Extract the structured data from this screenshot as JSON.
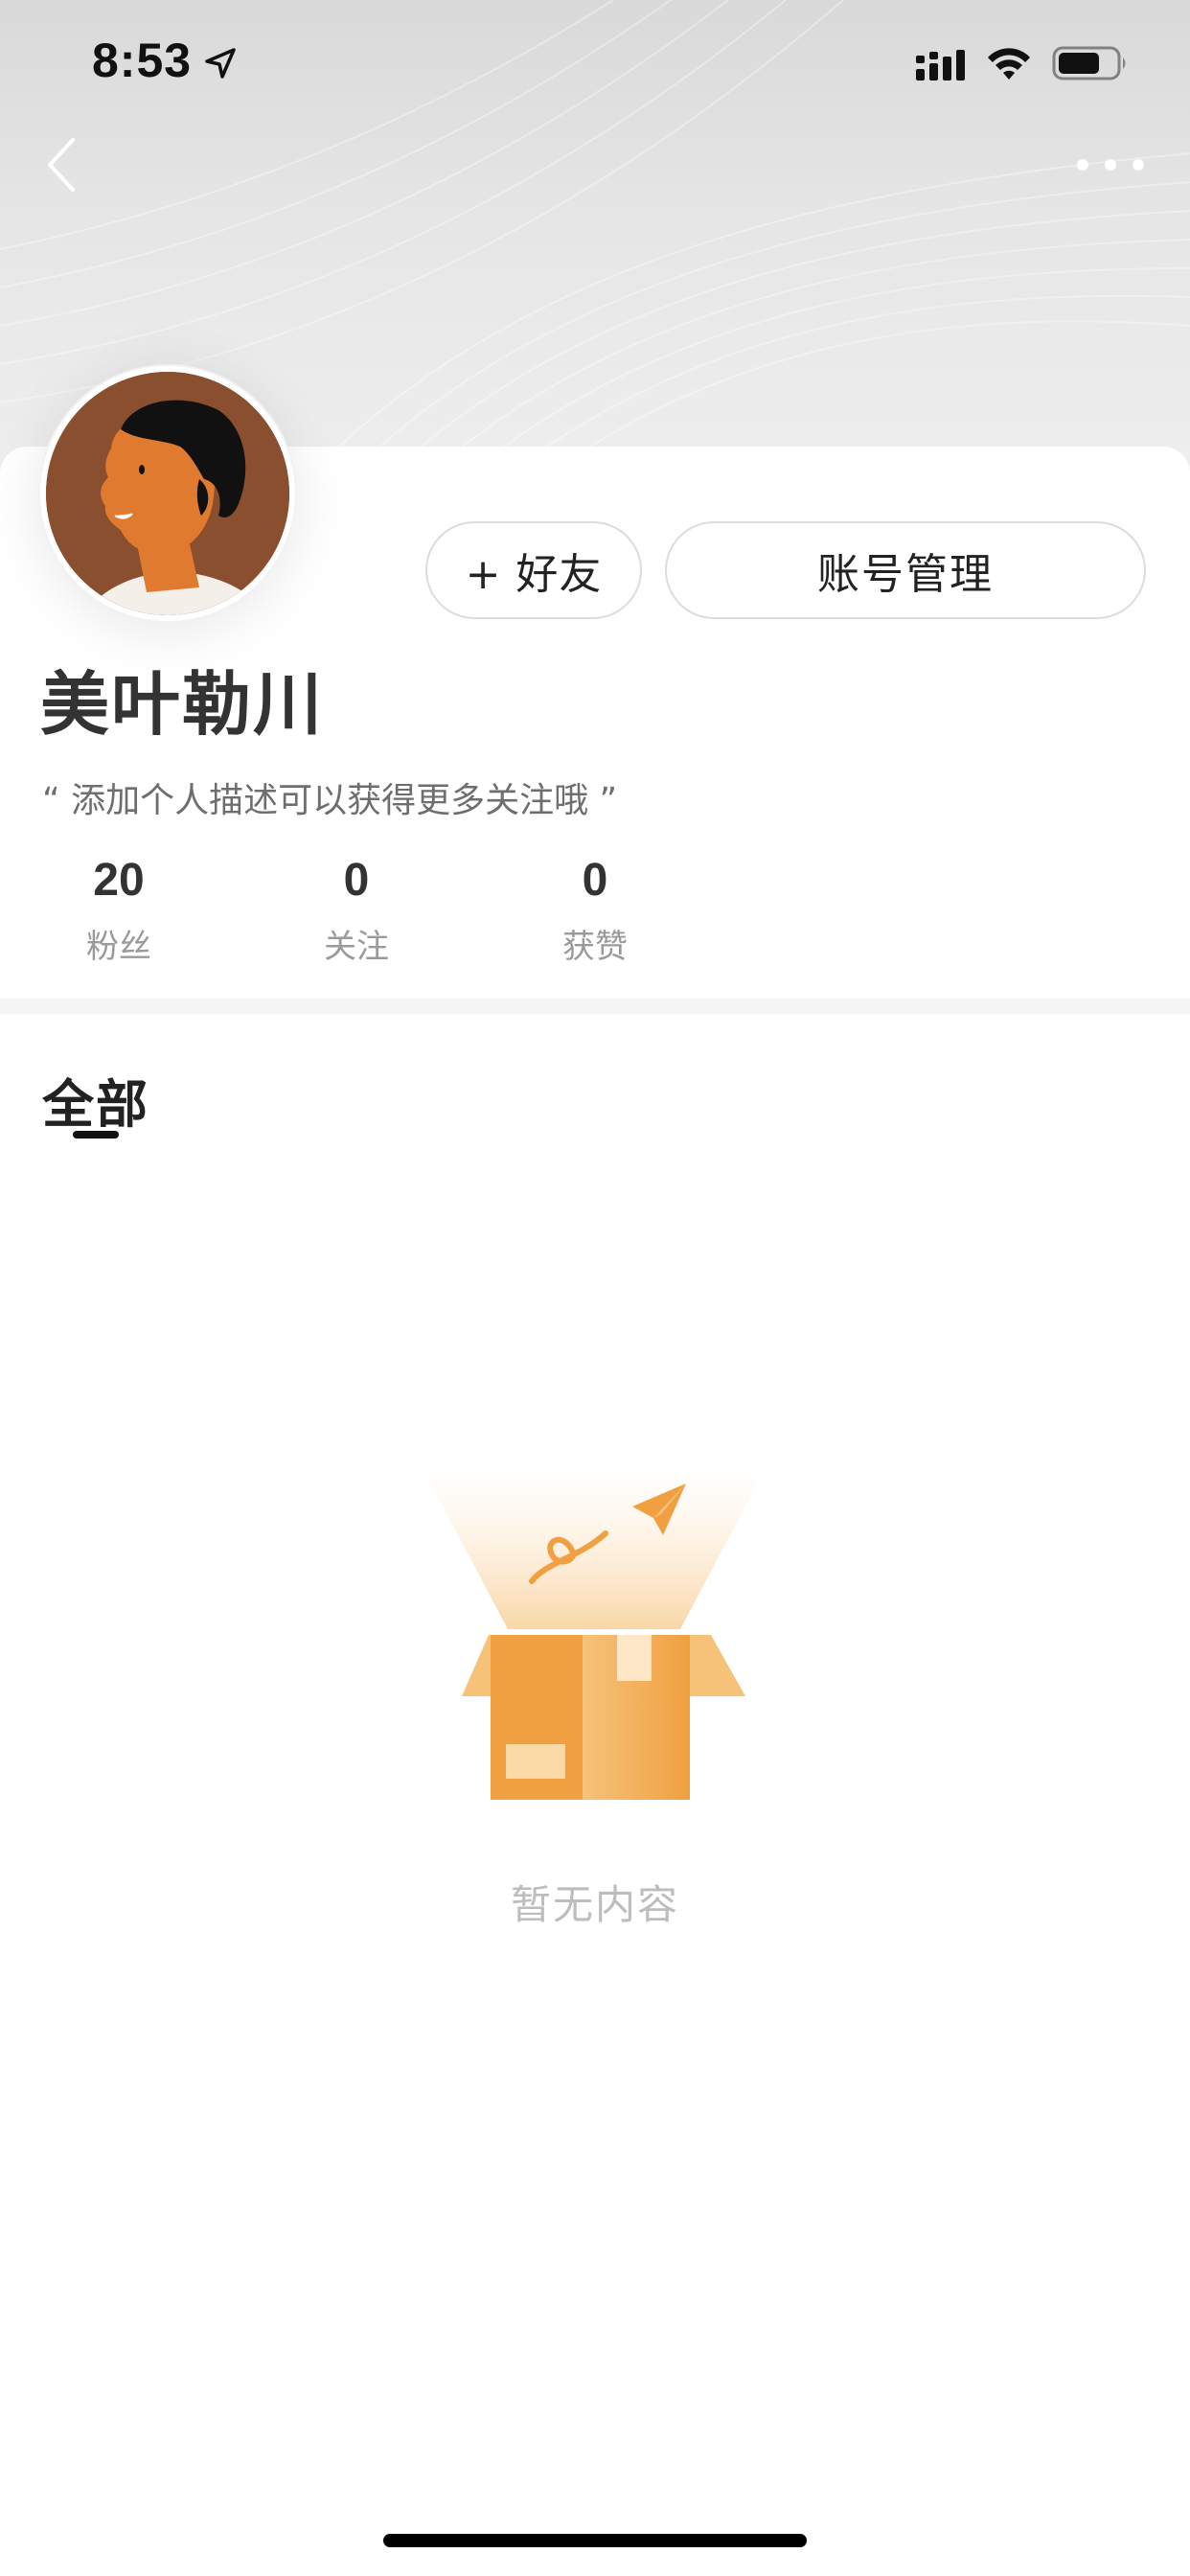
{
  "status_bar": {
    "time": "8:53",
    "location_icon": "location-arrow-icon",
    "signal_icon": "cellular-signal-icon",
    "wifi_icon": "wifi-icon",
    "battery_icon": "battery-icon"
  },
  "nav": {
    "back_icon": "chevron-left-icon",
    "more_icon": "more-dots-icon"
  },
  "profile": {
    "avatar_icon": "user-avatar",
    "name": "美叶勒川",
    "bio": "“ 添加个人描述可以获得更多关注哦 ”",
    "add_friend_label": "+ 好友",
    "account_manage_label": "账号管理"
  },
  "stats": [
    {
      "value": "20",
      "label": "粉丝"
    },
    {
      "value": "0",
      "label": "关注"
    },
    {
      "value": "0",
      "label": "获赞"
    }
  ],
  "tabs": [
    {
      "label": "全部",
      "active": true
    }
  ],
  "empty_state": {
    "illustration_icon": "empty-box-paper-plane-icon",
    "text": "暂无内容"
  },
  "colors": {
    "accent_orange": "#f0a040",
    "header_gray": "#e3e3e3",
    "text_dark": "#333333",
    "text_muted": "#9a9a9a"
  }
}
